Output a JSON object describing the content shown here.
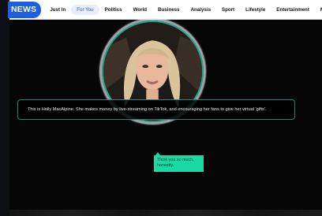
{
  "header": {
    "logo_text": "NEWS",
    "nav": [
      "Just In",
      "For You",
      "Politics",
      "World",
      "Business",
      "Analysis",
      "Sport",
      "Lifestyle",
      "Entertainment",
      "Mo"
    ],
    "active_index": 1
  },
  "story": {
    "caption": "This is Holly MacAlpine. She makes money by live-streaming on TikTok, and encouraging her fans to give her virtual 'gifts'.",
    "bubble": "Think you so much, honestly."
  },
  "colors": {
    "accent": "#1c5fe0",
    "ring": "#1aa78d",
    "bubble": "#1ad9a2"
  }
}
